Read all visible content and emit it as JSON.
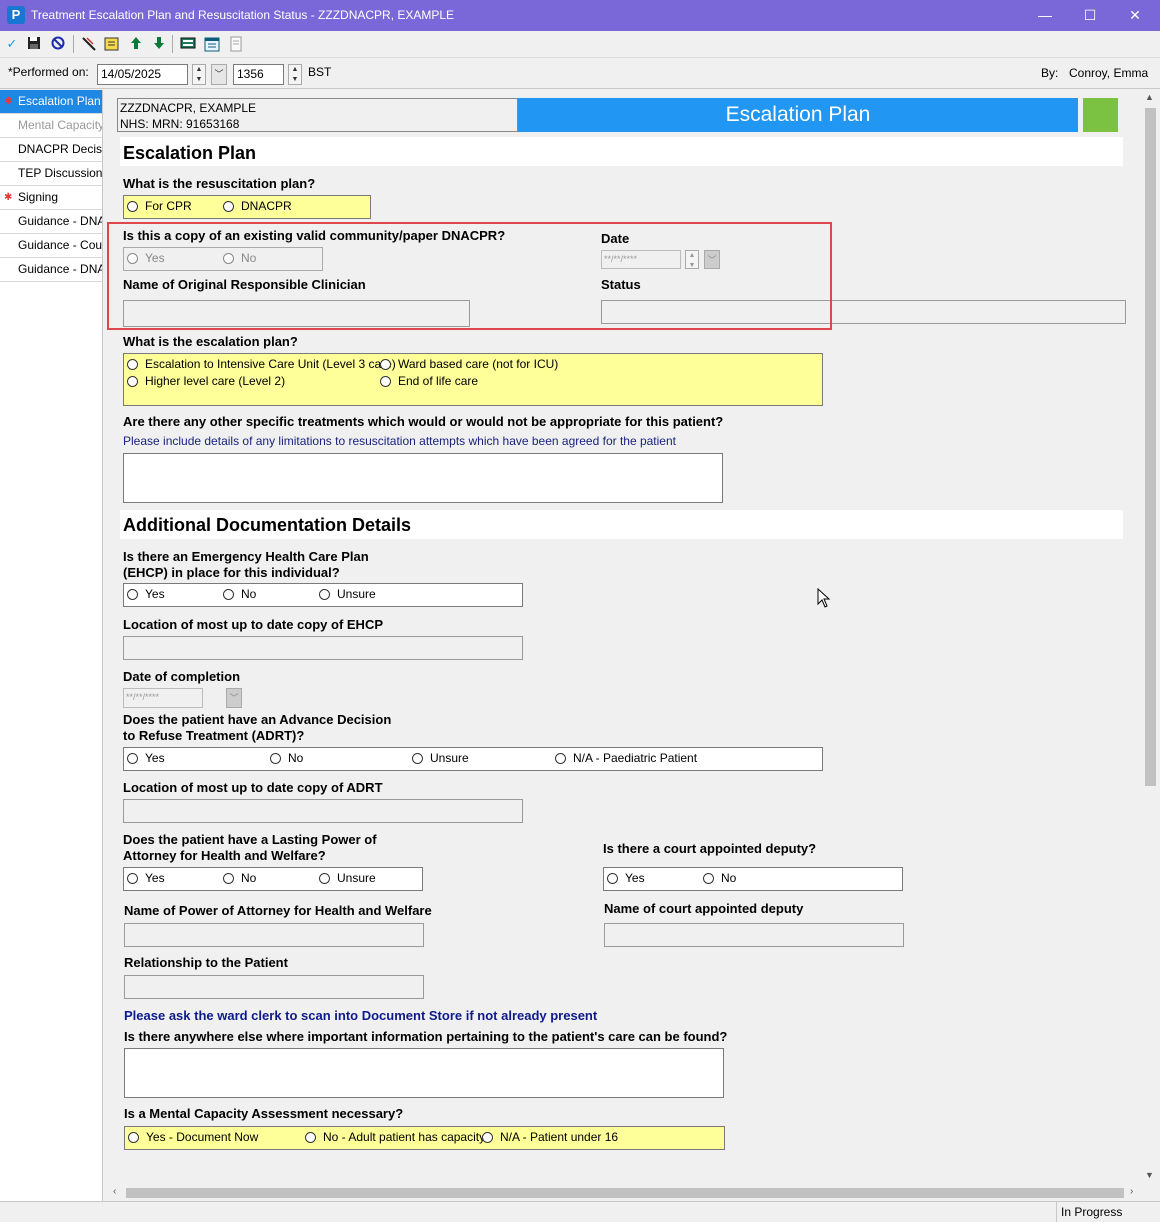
{
  "window": {
    "app_icon": "P",
    "title": "Treatment Escalation Plan and Resuscitation Status - ZZZDNACPR, EXAMPLE",
    "minimize": "—",
    "maximize": "☐",
    "close": "✕"
  },
  "toolbar": {
    "icons": [
      "checkmark-icon",
      "save-icon",
      "cancel-icon",
      "pen-icon",
      "note-icon",
      "arrow-up-icon",
      "arrow-down-icon",
      "keyboard-icon",
      "calendar-icon",
      "document-icon"
    ]
  },
  "performed": {
    "label": "*Performed on:",
    "date": "14/05/2025",
    "time": "1356",
    "tz": "BST",
    "by_label": "By:",
    "by_value": "Conroy, Emma"
  },
  "sidebar": {
    "items": [
      {
        "label": "Escalation Plan",
        "star": "✱",
        "state": "active"
      },
      {
        "label": "Mental Capacity A",
        "star": "",
        "state": "disabled"
      },
      {
        "label": "DNACPR Decision",
        "star": "",
        "state": "normal"
      },
      {
        "label": "TEP Discussion",
        "star": "",
        "state": "normal"
      },
      {
        "label": "Signing",
        "star": "✱",
        "state": "normal"
      },
      {
        "label": "Guidance - DNAC",
        "star": "",
        "state": "normal"
      },
      {
        "label": "Guidance - Count",
        "star": "",
        "state": "normal"
      },
      {
        "label": "Guidance - DNAC",
        "star": "",
        "state": "normal"
      }
    ]
  },
  "banner": {
    "patient_name": "ZZZDNACPR, EXAMPLE",
    "patient_ids": "NHS:   MRN: 91653168",
    "title": "Escalation Plan",
    "accent": "#2196f3",
    "status_color": "#7cc242"
  },
  "section1": {
    "header": "Escalation Plan",
    "resus_q": "What is the resuscitation plan?",
    "resus_opts": [
      "For CPR",
      "DNACPR"
    ],
    "copy_q": "Is this a copy of an existing valid community/paper DNACPR?",
    "copy_opts": [
      "Yes",
      "No"
    ],
    "date_label": "Date",
    "date_placeholder": "**/**/****",
    "clinician_label": "Name of Original Responsible Clinician",
    "status_label": "Status",
    "escal_q": "What is the escalation plan?",
    "escal_opts": [
      "Escalation to Intensive Care Unit (Level 3 care)",
      "Ward based care (not for ICU)",
      "Higher level care (Level 2)",
      "End of life care"
    ],
    "treat_q": "Are there any other specific treatments which would or would not be appropriate for this patient?",
    "treat_hint": "Please include details of any limitations to resuscitation attempts which have been agreed for the patient"
  },
  "section2": {
    "header": "Additional Documentation Details",
    "ehcp_q1": "Is there an Emergency Health Care Plan",
    "ehcp_q2": "(EHCP) in place for this individual?",
    "ehcp_opts": [
      "Yes",
      "No",
      "Unsure"
    ],
    "ehcp_loc": "Location of most up to date copy of EHCP",
    "date_completion": "Date of completion",
    "date_placeholder": "**/**/****",
    "adrt_q1": "Does the patient have an Advance Decision",
    "adrt_q2": "to Refuse Treatment (ADRT)?",
    "adrt_opts": [
      "Yes",
      "No",
      "Unsure",
      "N/A - Paediatric Patient"
    ],
    "adrt_loc": "Location of most up to date copy of ADRT",
    "lpa_q1": "Does the patient have a Lasting Power of",
    "lpa_q2": "Attorney for Health and Welfare?",
    "lpa_opts": [
      "Yes",
      "No",
      "Unsure"
    ],
    "deputy_q": "Is there a court appointed deputy?",
    "deputy_opts": [
      "Yes",
      "No"
    ],
    "poa_name": "Name of Power of Attorney for Health and Welfare",
    "deputy_name": "Name of court appointed deputy",
    "relationship": "Relationship to the Patient",
    "scan_hint": "Please ask the ward clerk to scan into Document Store if not already present",
    "other_info_q": "Is there anywhere else where important information pertaining to the patient's care can be found?",
    "mca_q": "Is a Mental Capacity Assessment necessary?",
    "mca_opts": [
      "Yes - Document Now",
      "No - Adult patient has capacity",
      "N/A - Patient under 16"
    ]
  },
  "status": {
    "text": "In Progress"
  }
}
